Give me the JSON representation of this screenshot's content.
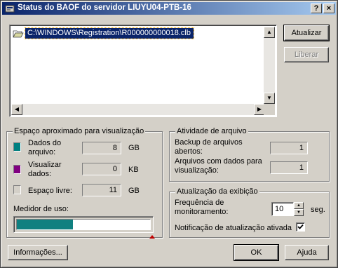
{
  "window": {
    "title": "Status do BAOF do servidor LIUYU04-PTB-16",
    "help_button": "?",
    "close_button": "×"
  },
  "file_list": {
    "items": [
      "C:\\WINDOWS\\Registration\\R000000000018.clb"
    ],
    "selected_index": 0
  },
  "side_buttons": {
    "refresh": "Atualizar",
    "release": "Liberar"
  },
  "space_group": {
    "title": "Espaço aproximado para visualização",
    "data_files_label": "Dados do\narquivo:",
    "data_files_value": "8",
    "data_files_unit": "GB",
    "data_files_color": "#008080",
    "view_data_label": "Visualizar\ndados:",
    "view_data_value": "0",
    "view_data_unit": "KB",
    "view_data_color": "#800080",
    "free_space_label": "Espaço livre:",
    "free_space_value": "11",
    "free_space_unit": "GB",
    "free_space_color": "#d4d0c8",
    "usage_meter_label": "Medidor de uso:",
    "usage_fraction": 0.42
  },
  "activity_group": {
    "title": "Atividade de arquivo",
    "backup_label": "Backup de arquivos\nabertos:",
    "backup_value": "1",
    "view_files_label": "Arquivos com dados para\nvisualização:",
    "view_files_value": "1"
  },
  "refresh_group": {
    "title": "Atualização da exibição",
    "frequency_label": "Frequência de\nmonitoramento:",
    "frequency_value": "10",
    "frequency_unit": "seg.",
    "notification_label": "Notificação de atualização ativada",
    "notification_checked": true
  },
  "footer": {
    "info_button": "Informações...",
    "ok_button": "OK",
    "help_button": "Ajuda"
  }
}
